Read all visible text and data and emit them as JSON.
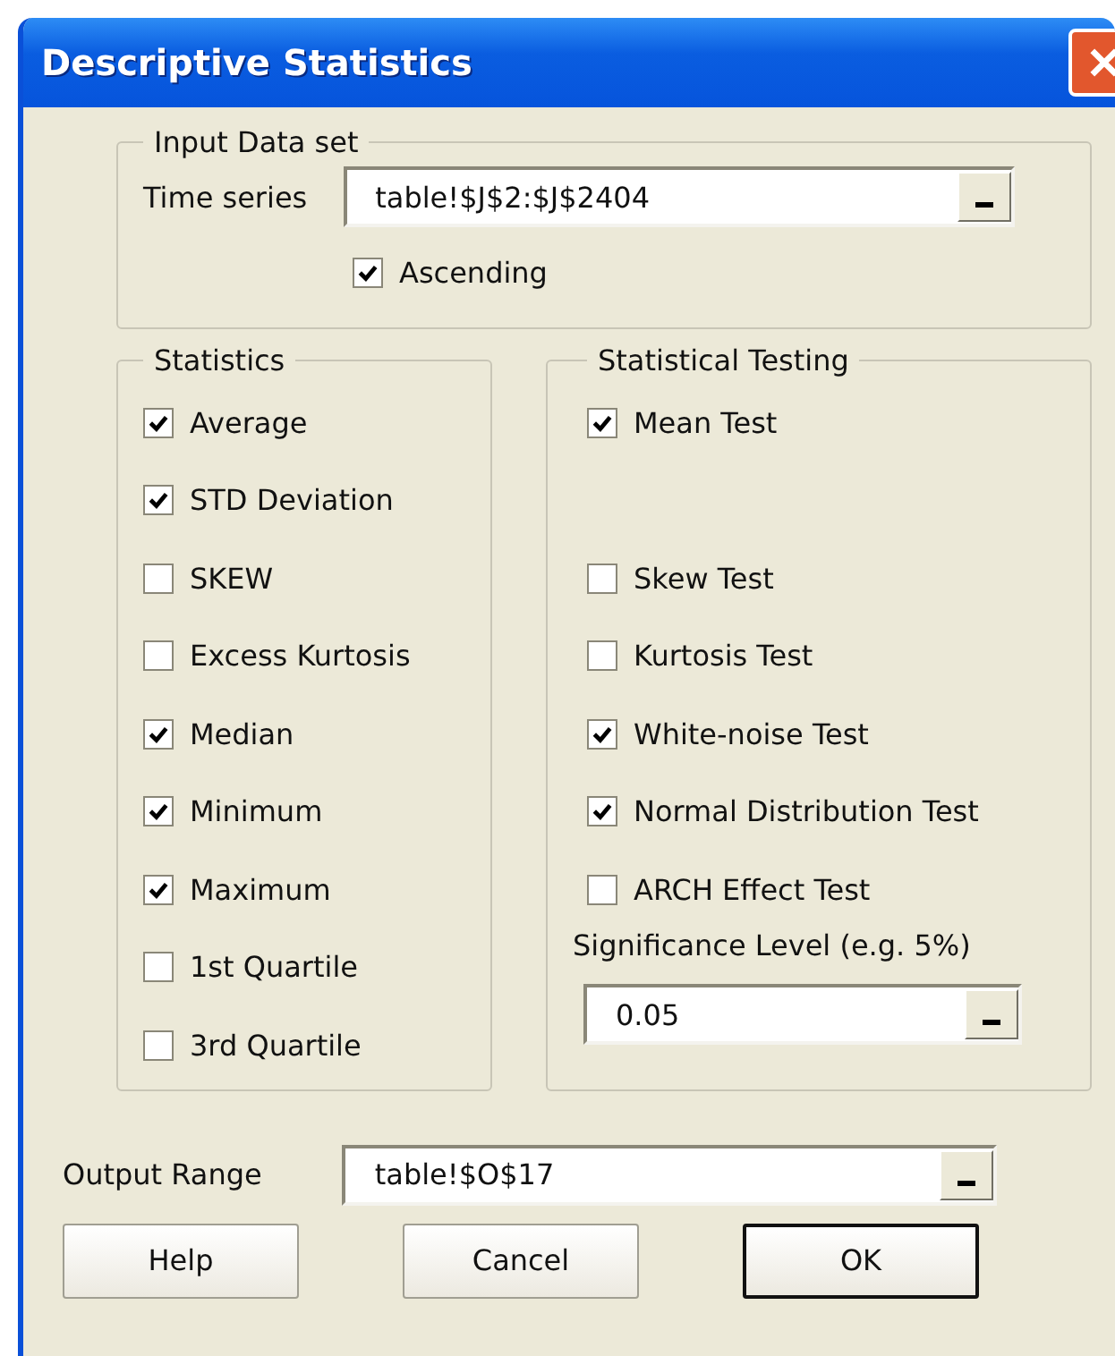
{
  "window": {
    "title": "Descriptive Statistics"
  },
  "input_data_set": {
    "title": "Input Data set",
    "time_series": {
      "label": "Time series",
      "value": "table!$J$2:$J$2404"
    },
    "ascending": {
      "label": "Ascending",
      "checked": true
    }
  },
  "statistics": {
    "title": "Statistics",
    "items": [
      {
        "label": "Average",
        "checked": true
      },
      {
        "label": "STD Deviation",
        "checked": true
      },
      {
        "label": "SKEW",
        "checked": false
      },
      {
        "label": "Excess Kurtosis",
        "checked": false
      },
      {
        "label": "Median",
        "checked": true
      },
      {
        "label": "Minimum",
        "checked": true
      },
      {
        "label": "Maximum",
        "checked": true
      },
      {
        "label": "1st Quartile",
        "checked": false
      },
      {
        "label": "3rd Quartile",
        "checked": false
      }
    ]
  },
  "statistical_testing": {
    "title": "Statistical Testing",
    "items": [
      {
        "label": "Mean Test",
        "checked": true
      },
      {
        "label": "Skew Test",
        "checked": false
      },
      {
        "label": "Kurtosis Test",
        "checked": false
      },
      {
        "label": "White-noise Test",
        "checked": true
      },
      {
        "label": "Normal Distribution Test",
        "checked": true
      },
      {
        "label": "ARCH Effect Test",
        "checked": false
      }
    ],
    "significance": {
      "label": "Significance Level (e.g. 5%)",
      "value": "0.05"
    }
  },
  "output_range": {
    "label": "Output Range",
    "value": "table!$O$17"
  },
  "buttons": [
    {
      "label": "Help",
      "default": false
    },
    {
      "label": "Cancel",
      "default": false
    },
    {
      "label": "OK",
      "default": true
    }
  ]
}
